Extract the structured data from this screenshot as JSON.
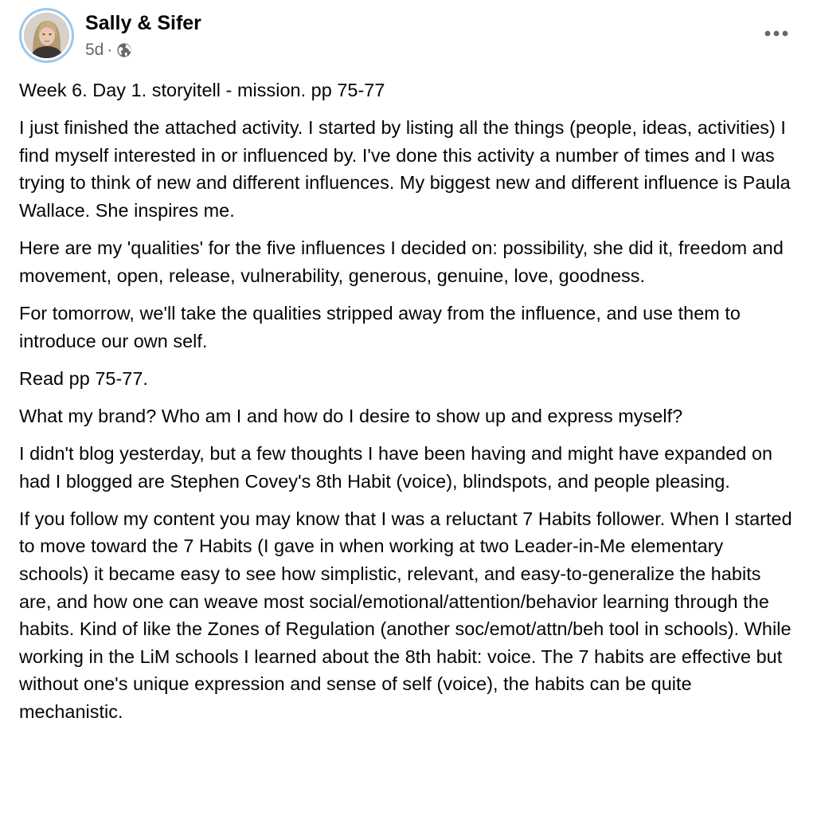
{
  "post": {
    "author": "Sally & Sifer",
    "time": "5d",
    "separator": "·",
    "audience_icon": "globe-icon",
    "more_icon": "more-options-icon",
    "paragraphs": [
      "Week 6. Day 1. storyitell - mission. pp 75-77",
      "I just finished the attached activity. I started by listing all the things (people, ideas, activities) I find myself interested in or influenced by. I've done this activity a number of times and I was trying to think of new and different influences. My biggest new and different influence is Paula Wallace. She inspires me.",
      "Here are my 'qualities' for the five influences I decided on: possibility, she did it, freedom and movement, open, release, vulnerability, generous, genuine, love, goodness.",
      "For tomorrow, we'll take the qualities stripped away from the influence, and use them to introduce our own self.",
      "Read pp 75-77.",
      "What my brand? Who am I and how do I desire to show up and express myself?",
      "I didn't blog yesterday, but a few thoughts I have been having and might have expanded on had I blogged are Stephen Covey's 8th Habit (voice), blindspots, and people pleasing.",
      "If you follow my content you may know that I was a reluctant 7 Habits follower. When I started to move toward the 7 Habits (I gave in when working at two Leader-in-Me elementary schools) it became easy to see how simplistic, relevant, and easy-to-generalize the habits are, and how one can weave most social/emotional/attention/behavior learning through the habits. Kind of like the Zones of Regulation (another soc/emot/attn/beh tool in schools). While working in the LiM schools I learned about the 8th habit: voice. The 7 habits are effective but without one's unique expression and sense of self (voice), the habits can be quite mechanistic."
    ]
  },
  "colors": {
    "text": "#050505",
    "secondary_text": "#65676b",
    "avatar_ring": "#9cc7ea"
  }
}
